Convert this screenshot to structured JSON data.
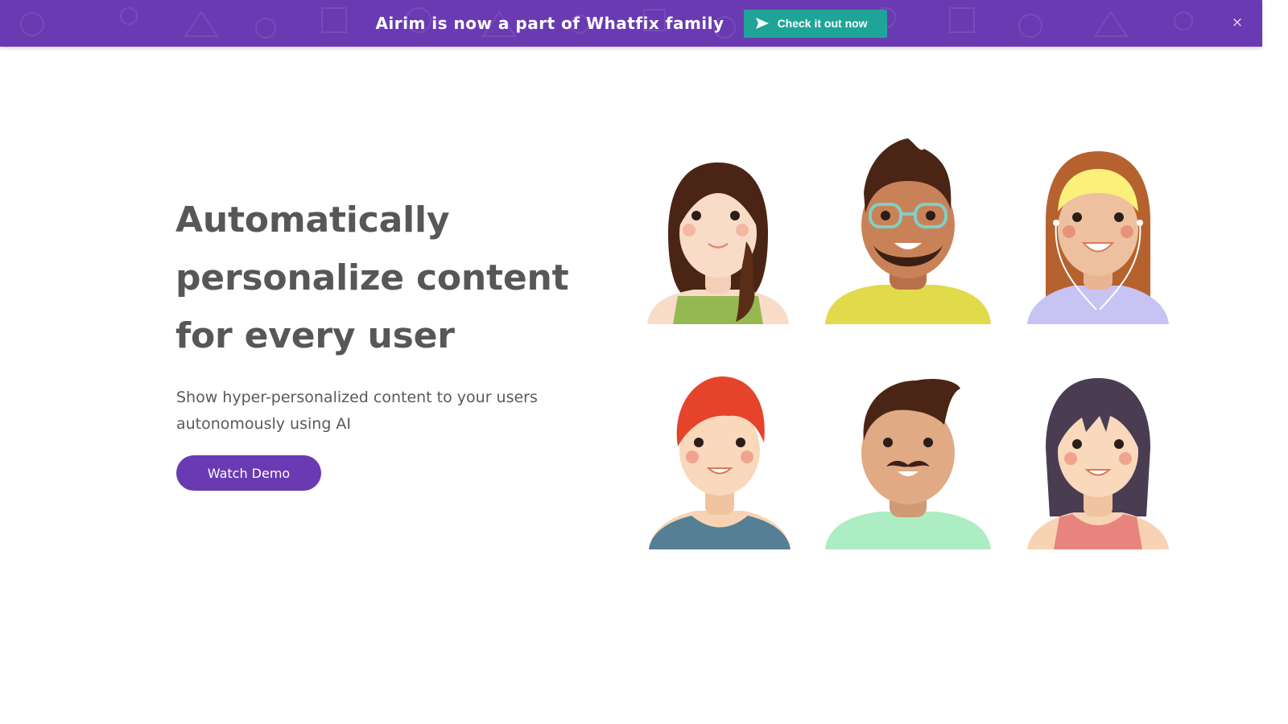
{
  "banner": {
    "message": "Airim is now a part of Whatfix family",
    "cta_label": "Check it out now",
    "cta_icon": "send-arrow-icon",
    "close_icon": "close-icon",
    "close_glyph": "×"
  },
  "hero": {
    "title": "Automatically personalize content for every user",
    "subtitle": "Show hyper-personalized content to your users autonomously using AI",
    "button_label": "Watch Demo"
  },
  "colors": {
    "brand_purple": "#6a3ab2",
    "cta_teal": "#1fa597",
    "heading_gray": "#575757",
    "text_gray": "#595959"
  }
}
